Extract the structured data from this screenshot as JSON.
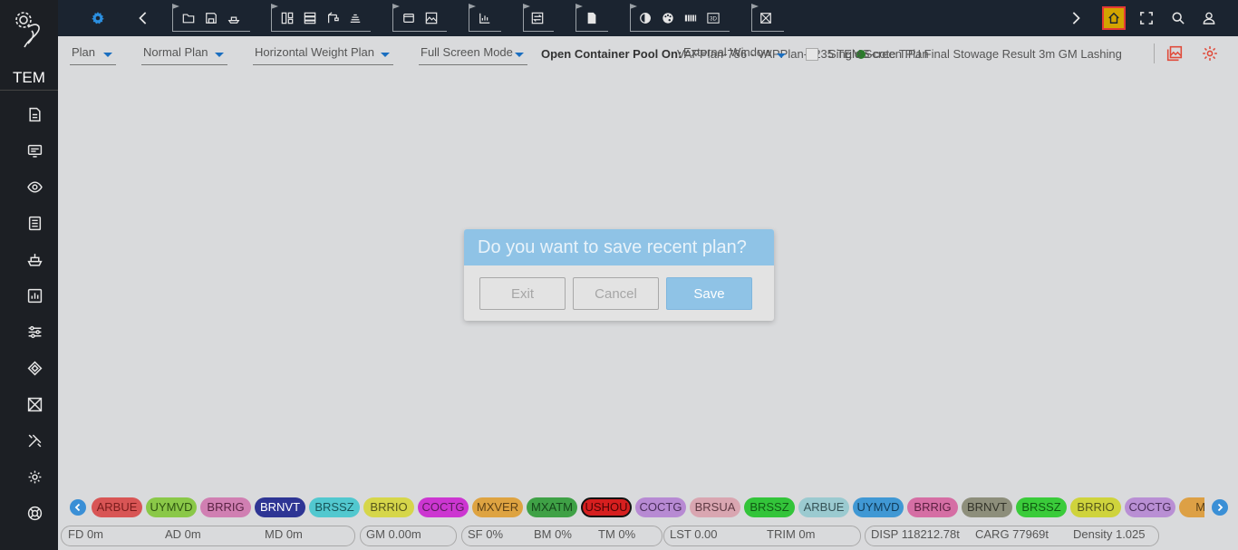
{
  "brand": "TEM",
  "icons": {
    "sidebar": [
      "document-icon",
      "monitor-icon",
      "eye-icon",
      "checklist-icon",
      "ship-icon",
      "bar-chart-icon",
      "sliders-icon",
      "diamond-icon",
      "crosshair-icon",
      "tools-icon",
      "gear-icon",
      "lifebuoy-icon"
    ],
    "topbar_left": [
      "settings-gear-icon",
      "back-chevron-icon"
    ],
    "topbar_right": [
      "forward-chevron-icon",
      "home-icon",
      "fullscreen-icon",
      "search-icon",
      "user-icon"
    ]
  },
  "toolbar": {
    "plan": "Plan",
    "plan_type": "Normal Plan",
    "weight_plan": "Horizontal Weight Plan",
    "screen_mode": "Full Screen Mode",
    "pool_label": "Open Container Pool On:",
    "ghost_top": "External Window",
    "plan_name": "VAPPlan-786 - VAPPlan-1235 TEMS-cote T.P.I Final Stowage Result 3m GM Lashing",
    "single_screen": "Single Screen Plan"
  },
  "dialog": {
    "title": "Do you want to save recent plan?",
    "exit": "Exit",
    "cancel": "Cancel",
    "save": "Save"
  },
  "ports": [
    {
      "code": "ARBUE",
      "bg": "#d85555",
      "fg": "#7a1c1c"
    },
    {
      "code": "UYMVD",
      "bg": "#8ac848",
      "fg": "#2e5410"
    },
    {
      "code": "BRRIG",
      "bg": "#d07fb2",
      "fg": "#5a2344"
    },
    {
      "code": "BRNVT",
      "bg": "#2e3594",
      "fg": "#ffffff"
    },
    {
      "code": "BRSSZ",
      "bg": "#52c8cf",
      "fg": "#175559"
    },
    {
      "code": "BRRIO",
      "bg": "#d6d64a",
      "fg": "#55551a"
    },
    {
      "code": "COCTG",
      "bg": "#cc36d1",
      "fg": "#581b5b"
    },
    {
      "code": "MXVER",
      "bg": "#dea341",
      "fg": "#5f4215"
    },
    {
      "code": "MXATM",
      "bg": "#3fa146",
      "fg": "#15461a"
    },
    {
      "code": "USHOU",
      "bg": "#d61f1f",
      "fg": "#4a0505",
      "selected": true
    },
    {
      "code": "COCTG",
      "bg": "#b78ad3",
      "fg": "#4a2e5a"
    },
    {
      "code": "BRSUA",
      "bg": "#d9a6b1",
      "fg": "#5f3a43"
    },
    {
      "code": "BRSSZ",
      "bg": "#33c43a",
      "fg": "#115a14"
    },
    {
      "code": "ARBUE",
      "bg": "#9bcad0",
      "fg": "#355256"
    },
    {
      "code": "UYMVD",
      "bg": "#4098d4",
      "fg": "#103a57"
    },
    {
      "code": "BRRIG",
      "bg": "#d56ea4",
      "fg": "#5a1f3f"
    },
    {
      "code": "BRNVT",
      "bg": "#8d8e7b",
      "fg": "#33342a"
    },
    {
      "code": "BRSSZ",
      "bg": "#3acb3a",
      "fg": "#0f5810"
    },
    {
      "code": "BRRIO",
      "bg": "#cfd33c",
      "fg": "#55561a"
    },
    {
      "code": "COCTG",
      "bg": "#b98fd4",
      "fg": "#4a2e5a"
    },
    {
      "code": "MX",
      "bg": "#dda045",
      "fg": "#5f4215"
    }
  ],
  "status": {
    "fd": "FD 0m",
    "ad": "AD 0m",
    "md": "MD 0m",
    "gm": "GM 0.00m",
    "sf": "SF 0%",
    "bm": "BM 0%",
    "tm": "TM 0%",
    "lst": "LST 0.00",
    "trim": "TRIM 0m",
    "disp": "DISP 118212.78t",
    "carg": "CARG 77969t",
    "density": "Density 1.025"
  }
}
